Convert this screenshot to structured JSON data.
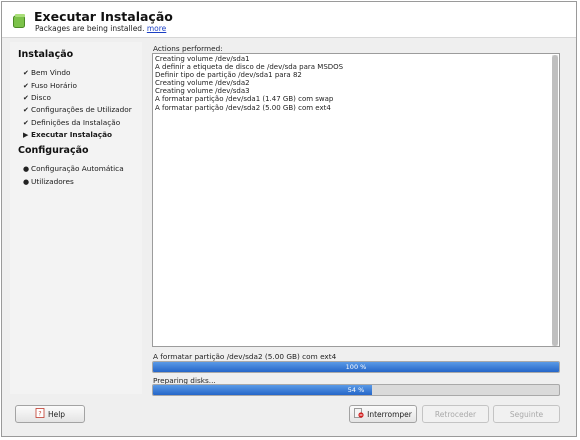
{
  "header": {
    "title": "Executar Instalação",
    "subtitle": "Packages are being installed.",
    "more_link": "more"
  },
  "sidebar": {
    "sections": [
      {
        "title": "Instalação",
        "steps": [
          {
            "label": "Bem Vindo",
            "state": "done"
          },
          {
            "label": "Fuso Horário",
            "state": "done"
          },
          {
            "label": "Disco",
            "state": "done"
          },
          {
            "label": "Configurações de Utilizador",
            "state": "done"
          },
          {
            "label": "Definições da Instalação",
            "state": "done"
          },
          {
            "label": "Executar Instalação",
            "state": "current"
          }
        ]
      },
      {
        "title": "Configuração",
        "steps": [
          {
            "label": "Configuração Automática",
            "state": "pending"
          },
          {
            "label": "Utilizadores",
            "state": "pending"
          }
        ]
      }
    ]
  },
  "log": {
    "label": "Actions performed:",
    "lines": [
      "Creating volume /dev/sda1",
      "A definir a etiqueta de disco de /dev/sda para MSDOS",
      "Definir tipo de partição /dev/sda1 para 82",
      "Creating volume /dev/sda2",
      "Creating volume /dev/sda3",
      "A formatar partição /dev/sda1 (1.47 GB) com swap",
      "A formatar partição /dev/sda2 (5.00 GB) com ext4"
    ]
  },
  "progress": {
    "current_label": "A formatar partição /dev/sda2 (5.00 GB) com ext4",
    "current_percent": 100,
    "current_text": "100 %",
    "overall_label": "Preparing disks...",
    "overall_percent": 54,
    "overall_text": "54 %"
  },
  "buttons": {
    "help": "Help",
    "abort": "Interromper",
    "back": "Retroceder",
    "next": "Seguinte"
  },
  "colors": {
    "progress_fill": "#2f74d0",
    "link": "#1b3fc4"
  },
  "icons": {
    "app": "installer-icon",
    "done": "check-icon",
    "current": "arrow-right-icon",
    "pending": "bullet-icon",
    "help": "help-book-icon",
    "abort": "stop-icon"
  }
}
